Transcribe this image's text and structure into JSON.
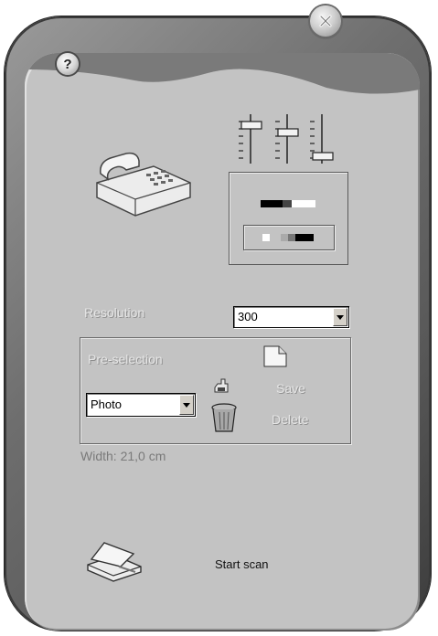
{
  "window": {
    "close_icon": "close-icon",
    "help_label": "?"
  },
  "settings": {
    "resolution_label": "Resolution",
    "resolution_value": "300",
    "preselection_label": "Pre-selection",
    "preselection_value": "Photo",
    "save_label": "Save",
    "delete_label": "Delete",
    "width_text": "Width: 21,0 cm"
  },
  "actions": {
    "start_scan_label": "Start scan"
  },
  "colors": {
    "panel": "#c3c3c3",
    "frame": "#5a5a5a",
    "dim_text": "#e6e6e6"
  }
}
